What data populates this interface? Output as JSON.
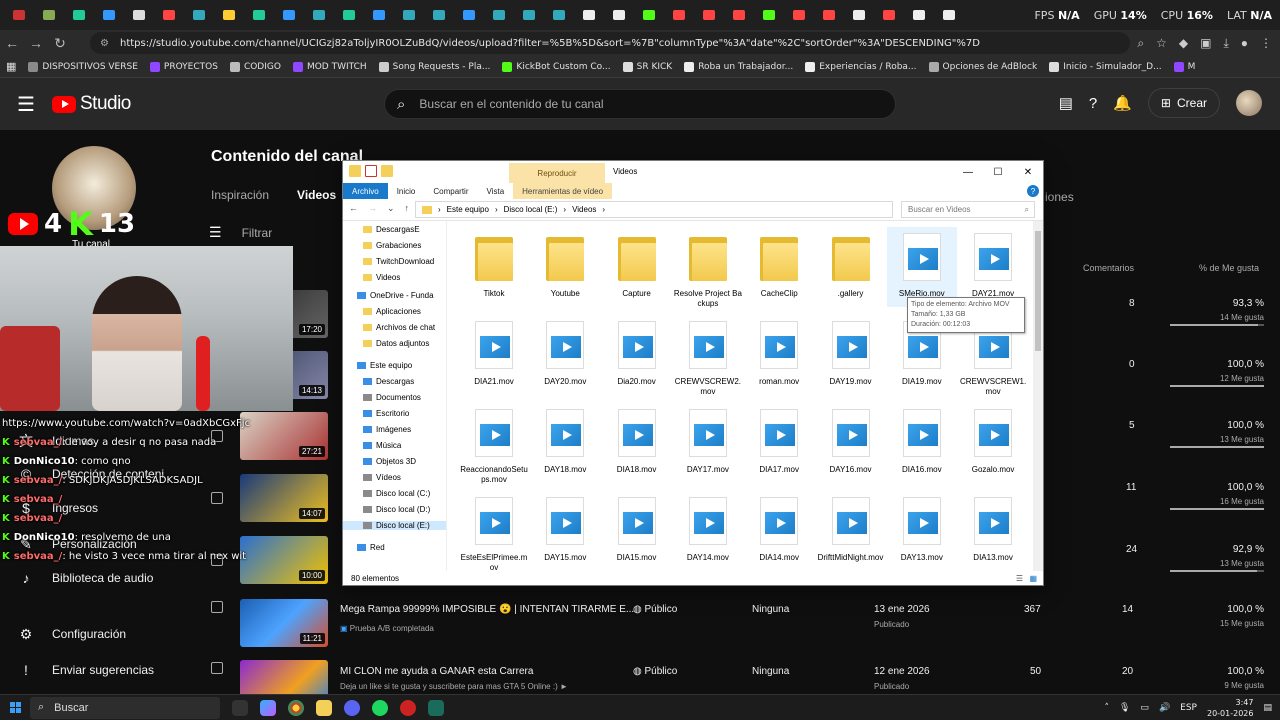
{
  "browser": {
    "url": "https://studio.youtube.com/channel/UCIGzj82aToljyIR0OLZuBdQ/videos/upload?filter=%5B%5D&sort=%7B\"columnType\"%3A\"date\"%2C\"sortOrder\"%3A\"DESCENDING\"%7D",
    "perf": {
      "fps_label": "FPS",
      "fps_value": "N/A",
      "gpu_label": "GPU",
      "gpu_value": "14%",
      "cpu_label": "CPU",
      "cpu_value": "16%",
      "lat_label": "LAT",
      "lat_value": "N/A"
    },
    "bookmarks": [
      {
        "label": "DISPOSITIVOS VERSE",
        "color": "#8a8a8a"
      },
      {
        "label": "PROYECTOS",
        "color": "#9147ff"
      },
      {
        "label": "CODIGO",
        "color": "#bbbbbb"
      },
      {
        "label": "MOD TWITCH",
        "color": "#9147ff"
      },
      {
        "label": "Song Requests - Pla...",
        "color": "#cccccc"
      },
      {
        "label": "KickBot Custom Co...",
        "color": "#53fc18"
      },
      {
        "label": "SR KICK",
        "color": "#dddddd"
      },
      {
        "label": "Roba un Trabajador...",
        "color": "#eeeeee"
      },
      {
        "label": "Experiencias / Roba...",
        "color": "#eeeeee"
      },
      {
        "label": "Opciones de AdBlock",
        "color": "#aaaaaa"
      },
      {
        "label": "Inicio - Simulador_D...",
        "color": "#dddddd"
      },
      {
        "label": "M",
        "color": "#9147ff"
      }
    ]
  },
  "studio": {
    "logo": "Studio",
    "search_placeholder": "Buscar en el contenido de tu canal",
    "create_label": "Crear",
    "page_title": "Contenido del canal",
    "tabs": [
      {
        "label": "Inspiración"
      },
      {
        "label": "Videos"
      }
    ],
    "tab_tail": "iones",
    "filter_label": "Filtrar",
    "sidebar": [
      {
        "label": "Idiomas"
      },
      {
        "label": "Detección de conteni"
      },
      {
        "label": "Ingresos"
      },
      {
        "label": "Personalización"
      },
      {
        "label": "Biblioteca de audio"
      },
      {
        "label": "Configuración"
      },
      {
        "label": "Enviar sugerencias"
      }
    ],
    "channel_label": "Tu canal",
    "columns": {
      "comments": "Comentarios",
      "likes": "% de Me gusta"
    },
    "rows": [
      {
        "comments": "8",
        "likes_pct": "93,3 %",
        "likes": "14 Me gusta",
        "fill": 0.933
      },
      {
        "comments": "0",
        "likes_pct": "100,0 %",
        "likes": "12 Me gusta",
        "fill": 1.0
      },
      {
        "comments": "5",
        "likes_pct": "100,0 %",
        "likes": "13 Me gusta",
        "fill": 1.0
      },
      {
        "comments": "11",
        "likes_pct": "100,0 %",
        "likes": "16 Me gusta",
        "fill": 1.0
      },
      {
        "comments": "24",
        "likes_pct": "92,9 %",
        "likes": "13 Me gusta",
        "fill": 0.929
      }
    ],
    "videos": [
      {
        "title": "Mega Rampa 99999% IMPOSIBLE 😮 | INTENTAN TIRARME E...",
        "sub": "Prueba A/B completada",
        "visibility": "Público",
        "restrictions": "Ninguna",
        "date": "13 ene 2026",
        "date_status": "Publicado",
        "views": "367",
        "comments": "14",
        "likes_pct": "100,0 %",
        "likes": "15 Me gusta",
        "duration": "11:21"
      },
      {
        "title": "MI CLON me ayuda a GANAR esta Carrera",
        "sub": "Deja un like si te gusta y suscribete para mas GTA 5 Online :) ►",
        "visibility": "Público",
        "restrictions": "Ninguna",
        "date": "12 ene 2026",
        "date_status": "Publicado",
        "views": "50",
        "comments": "20",
        "likes_pct": "100,0 %",
        "likes": "9 Me gusta",
        "duration": ""
      }
    ],
    "thumb_durations": [
      "17:20",
      "14:13",
      "27:21",
      "14:07",
      "10:00"
    ]
  },
  "stream": {
    "yt_count": "4",
    "kick_count": "13",
    "chat": [
      {
        "user": "",
        "text": "https://www.youtube.com/watch?v=0adXbCGxFjc",
        "kick": false
      },
      {
        "user": "sebvaa_/",
        "text": ": le voy a desir q no pasa nada",
        "kick": true
      },
      {
        "user": "DonNico10",
        "text": ": como qno",
        "kick": true
      },
      {
        "user": "sebvaa_/",
        "text": ": SDKJDKJASDJKLSADKSADJL",
        "kick": true
      },
      {
        "user": "sebvaa_/",
        "text": "",
        "kick": true
      },
      {
        "user": "sebvaa_/",
        "text": "",
        "kick": true
      },
      {
        "user": "DonNico10",
        "text": ": resolvemo de una",
        "kick": true
      },
      {
        "user": "sebvaa_/",
        "text": ": he visto 3 vece nma tirar al nex wit",
        "kick": true
      }
    ]
  },
  "explorer": {
    "context_tab": "Reproducir",
    "title": "Videos",
    "ribbon": [
      "Archivo",
      "Inicio",
      "Compartir",
      "Vista",
      "Herramientas de vídeo"
    ],
    "path": [
      "Este equipo",
      "Disco local (E:)",
      "Videos"
    ],
    "search_placeholder": "Buscar en Videos",
    "nav": [
      {
        "label": "DescargasE",
        "kind": "f"
      },
      {
        "label": "Grabaciones",
        "kind": "f"
      },
      {
        "label": "TwitchDownload",
        "kind": "f"
      },
      {
        "label": "Videos",
        "kind": "f"
      },
      {
        "label": "OneDrive - Funda",
        "kind": "b"
      },
      {
        "label": "Aplicaciones",
        "kind": "f"
      },
      {
        "label": "Archivos de chat",
        "kind": "f"
      },
      {
        "label": "Datos adjuntos",
        "kind": "f"
      },
      {
        "label": "Este equipo",
        "kind": "b"
      },
      {
        "label": "Descargas",
        "kind": "b"
      },
      {
        "label": "Documentos",
        "kind": "g"
      },
      {
        "label": "Escritorio",
        "kind": "b"
      },
      {
        "label": "Imágenes",
        "kind": "b"
      },
      {
        "label": "Música",
        "kind": "b"
      },
      {
        "label": "Objetos 3D",
        "kind": "b"
      },
      {
        "label": "Vídeos",
        "kind": "g"
      },
      {
        "label": "Disco local (C:)",
        "kind": "g"
      },
      {
        "label": "Disco local (D:)",
        "kind": "g"
      },
      {
        "label": "Disco local (E:)",
        "kind": "g"
      },
      {
        "label": "Red",
        "kind": "b"
      }
    ],
    "items": [
      {
        "name": "Tiktok",
        "type": "folder"
      },
      {
        "name": "Youtube",
        "type": "folder"
      },
      {
        "name": "Capture",
        "type": "folder"
      },
      {
        "name": "Resolve Project Backups",
        "type": "folder"
      },
      {
        "name": "CacheClip",
        "type": "folder"
      },
      {
        "name": ".gallery",
        "type": "folder"
      },
      {
        "name": "SMeRio.mov",
        "type": "video"
      },
      {
        "name": "DAY21.mov",
        "type": "video"
      },
      {
        "name": "DIA21.mov",
        "type": "video"
      },
      {
        "name": "DAY20.mov",
        "type": "video"
      },
      {
        "name": "Dia20.mov",
        "type": "video"
      },
      {
        "name": "CREWVSCREW2.mov",
        "type": "video"
      },
      {
        "name": "roman.mov",
        "type": "video"
      },
      {
        "name": "DAY19.mov",
        "type": "video"
      },
      {
        "name": "DIA19.mov",
        "type": "video"
      },
      {
        "name": "CREWVSCREW1.mov",
        "type": "video"
      },
      {
        "name": "ReaccionandoSetups.mov",
        "type": "video"
      },
      {
        "name": "DAY18.mov",
        "type": "video"
      },
      {
        "name": "DIA18.mov",
        "type": "video"
      },
      {
        "name": "DAY17.mov",
        "type": "video"
      },
      {
        "name": "DIA17.mov",
        "type": "video"
      },
      {
        "name": "DAY16.mov",
        "type": "video"
      },
      {
        "name": "DIA16.mov",
        "type": "video"
      },
      {
        "name": "Gozalo.mov",
        "type": "video"
      },
      {
        "name": "EsteEsElPrimee.mov",
        "type": "video"
      },
      {
        "name": "DAY15.mov",
        "type": "video"
      },
      {
        "name": "DIA15.mov",
        "type": "video"
      },
      {
        "name": "DAY14.mov",
        "type": "video"
      },
      {
        "name": "DIA14.mov",
        "type": "video"
      },
      {
        "name": "DrifttMidNight.mov",
        "type": "video"
      },
      {
        "name": "DAY13.mov",
        "type": "video"
      },
      {
        "name": "DIA13.mov",
        "type": "video"
      }
    ],
    "tooltip": {
      "type": "Tipo de elemento: Archivo MOV",
      "size": "Tamaño: 1,33 GB",
      "duration": "Duración: 00:12:03"
    },
    "status": "80 elementos"
  },
  "taskbar": {
    "search": "Buscar",
    "lang": "ESP",
    "time": "3:47",
    "date": "20-01-2026"
  }
}
